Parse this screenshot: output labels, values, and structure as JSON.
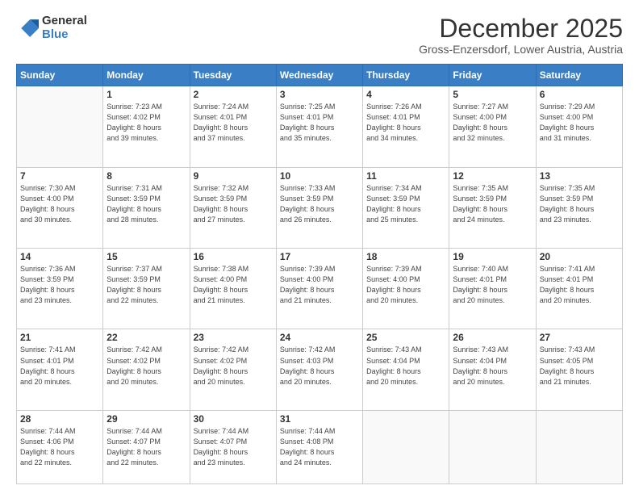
{
  "logo": {
    "general": "General",
    "blue": "Blue"
  },
  "header": {
    "month": "December 2025",
    "location": "Gross-Enzersdorf, Lower Austria, Austria"
  },
  "weekdays": [
    "Sunday",
    "Monday",
    "Tuesday",
    "Wednesday",
    "Thursday",
    "Friday",
    "Saturday"
  ],
  "weeks": [
    [
      {
        "day": "",
        "info": ""
      },
      {
        "day": "1",
        "info": "Sunrise: 7:23 AM\nSunset: 4:02 PM\nDaylight: 8 hours\nand 39 minutes."
      },
      {
        "day": "2",
        "info": "Sunrise: 7:24 AM\nSunset: 4:01 PM\nDaylight: 8 hours\nand 37 minutes."
      },
      {
        "day": "3",
        "info": "Sunrise: 7:25 AM\nSunset: 4:01 PM\nDaylight: 8 hours\nand 35 minutes."
      },
      {
        "day": "4",
        "info": "Sunrise: 7:26 AM\nSunset: 4:01 PM\nDaylight: 8 hours\nand 34 minutes."
      },
      {
        "day": "5",
        "info": "Sunrise: 7:27 AM\nSunset: 4:00 PM\nDaylight: 8 hours\nand 32 minutes."
      },
      {
        "day": "6",
        "info": "Sunrise: 7:29 AM\nSunset: 4:00 PM\nDaylight: 8 hours\nand 31 minutes."
      }
    ],
    [
      {
        "day": "7",
        "info": "Sunrise: 7:30 AM\nSunset: 4:00 PM\nDaylight: 8 hours\nand 30 minutes."
      },
      {
        "day": "8",
        "info": "Sunrise: 7:31 AM\nSunset: 3:59 PM\nDaylight: 8 hours\nand 28 minutes."
      },
      {
        "day": "9",
        "info": "Sunrise: 7:32 AM\nSunset: 3:59 PM\nDaylight: 8 hours\nand 27 minutes."
      },
      {
        "day": "10",
        "info": "Sunrise: 7:33 AM\nSunset: 3:59 PM\nDaylight: 8 hours\nand 26 minutes."
      },
      {
        "day": "11",
        "info": "Sunrise: 7:34 AM\nSunset: 3:59 PM\nDaylight: 8 hours\nand 25 minutes."
      },
      {
        "day": "12",
        "info": "Sunrise: 7:35 AM\nSunset: 3:59 PM\nDaylight: 8 hours\nand 24 minutes."
      },
      {
        "day": "13",
        "info": "Sunrise: 7:35 AM\nSunset: 3:59 PM\nDaylight: 8 hours\nand 23 minutes."
      }
    ],
    [
      {
        "day": "14",
        "info": "Sunrise: 7:36 AM\nSunset: 3:59 PM\nDaylight: 8 hours\nand 23 minutes."
      },
      {
        "day": "15",
        "info": "Sunrise: 7:37 AM\nSunset: 3:59 PM\nDaylight: 8 hours\nand 22 minutes."
      },
      {
        "day": "16",
        "info": "Sunrise: 7:38 AM\nSunset: 4:00 PM\nDaylight: 8 hours\nand 21 minutes."
      },
      {
        "day": "17",
        "info": "Sunrise: 7:39 AM\nSunset: 4:00 PM\nDaylight: 8 hours\nand 21 minutes."
      },
      {
        "day": "18",
        "info": "Sunrise: 7:39 AM\nSunset: 4:00 PM\nDaylight: 8 hours\nand 20 minutes."
      },
      {
        "day": "19",
        "info": "Sunrise: 7:40 AM\nSunset: 4:01 PM\nDaylight: 8 hours\nand 20 minutes."
      },
      {
        "day": "20",
        "info": "Sunrise: 7:41 AM\nSunset: 4:01 PM\nDaylight: 8 hours\nand 20 minutes."
      }
    ],
    [
      {
        "day": "21",
        "info": "Sunrise: 7:41 AM\nSunset: 4:01 PM\nDaylight: 8 hours\nand 20 minutes."
      },
      {
        "day": "22",
        "info": "Sunrise: 7:42 AM\nSunset: 4:02 PM\nDaylight: 8 hours\nand 20 minutes."
      },
      {
        "day": "23",
        "info": "Sunrise: 7:42 AM\nSunset: 4:02 PM\nDaylight: 8 hours\nand 20 minutes."
      },
      {
        "day": "24",
        "info": "Sunrise: 7:42 AM\nSunset: 4:03 PM\nDaylight: 8 hours\nand 20 minutes."
      },
      {
        "day": "25",
        "info": "Sunrise: 7:43 AM\nSunset: 4:04 PM\nDaylight: 8 hours\nand 20 minutes."
      },
      {
        "day": "26",
        "info": "Sunrise: 7:43 AM\nSunset: 4:04 PM\nDaylight: 8 hours\nand 20 minutes."
      },
      {
        "day": "27",
        "info": "Sunrise: 7:43 AM\nSunset: 4:05 PM\nDaylight: 8 hours\nand 21 minutes."
      }
    ],
    [
      {
        "day": "28",
        "info": "Sunrise: 7:44 AM\nSunset: 4:06 PM\nDaylight: 8 hours\nand 22 minutes."
      },
      {
        "day": "29",
        "info": "Sunrise: 7:44 AM\nSunset: 4:07 PM\nDaylight: 8 hours\nand 22 minutes."
      },
      {
        "day": "30",
        "info": "Sunrise: 7:44 AM\nSunset: 4:07 PM\nDaylight: 8 hours\nand 23 minutes."
      },
      {
        "day": "31",
        "info": "Sunrise: 7:44 AM\nSunset: 4:08 PM\nDaylight: 8 hours\nand 24 minutes."
      },
      {
        "day": "",
        "info": ""
      },
      {
        "day": "",
        "info": ""
      },
      {
        "day": "",
        "info": ""
      }
    ]
  ]
}
